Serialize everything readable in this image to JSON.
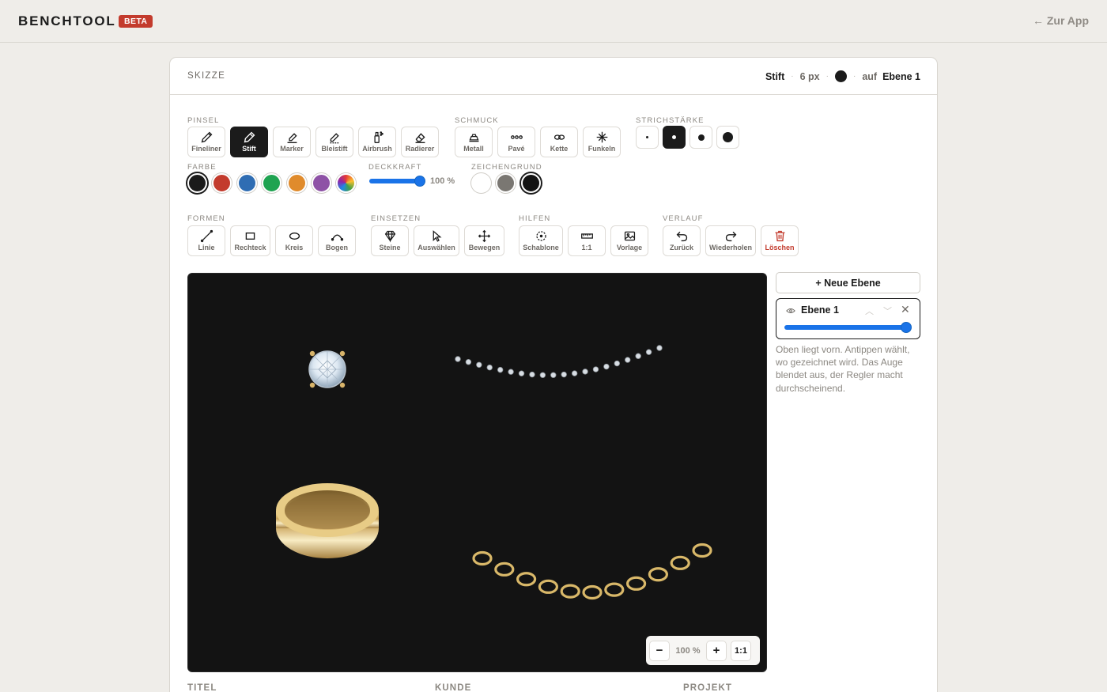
{
  "app": {
    "brand": "BENCHTOOL",
    "badge": "BETA",
    "back_link": "← Zur App"
  },
  "panel": {
    "title": "SKIZZE",
    "status": {
      "tool": "Stift",
      "size": "6 px",
      "on": "auf",
      "layer": "Ebene 1",
      "color": "#1b1b1b"
    }
  },
  "groups": {
    "pinsel": "PINSEL",
    "schmuck": "SCHMUCK",
    "strichstaerke": "STRICHSTÄRKE",
    "farbe": "FARBE",
    "deckkraft": "DECKKRAFT",
    "zeichengrund": "ZEICHENGRUND",
    "formen": "FORMEN",
    "einsetzen": "EINSETZEN",
    "hilfen": "HILFEN",
    "verlauf": "VERLAUF"
  },
  "brushes": [
    "Fineliner",
    "Stift",
    "Marker",
    "Bleistift",
    "Airbrush",
    "Radierer"
  ],
  "jewelry": [
    "Metall",
    "Pavé",
    "Kette",
    "Funkeln"
  ],
  "colors": [
    "#1b1b1b",
    "#c33b2d",
    "#2f6db3",
    "#1fa351",
    "#e08b2c",
    "#8e52a6"
  ],
  "opacity": {
    "value": "100 %",
    "fraction": 1.0
  },
  "backgrounds": [
    "#ffffff",
    "#7a7772",
    "#131313"
  ],
  "shapes": [
    "Linie",
    "Rechteck",
    "Kreis",
    "Bogen"
  ],
  "insert": [
    "Steine",
    "Auswählen",
    "Bewegen"
  ],
  "helpers": [
    "Schablone",
    "1:1",
    "Vorlage"
  ],
  "history": [
    "Zurück",
    "Wiederholen",
    "Löschen"
  ],
  "zoom": {
    "minus": "−",
    "value": "100 %",
    "plus": "+",
    "reset": "1:1"
  },
  "layers": {
    "new_button": "+ Neue Ebene",
    "items": [
      {
        "name": "Ebene 1",
        "opacity": 1.0
      }
    ],
    "help": "Oben liegt vorn. Antippen wählt, wo gezeichnet wird. Das Auge blendet aus, der Regler macht durchscheinend."
  },
  "fields": {
    "title": "TITEL",
    "customer": "KUNDE",
    "project": "PROJEKT"
  }
}
